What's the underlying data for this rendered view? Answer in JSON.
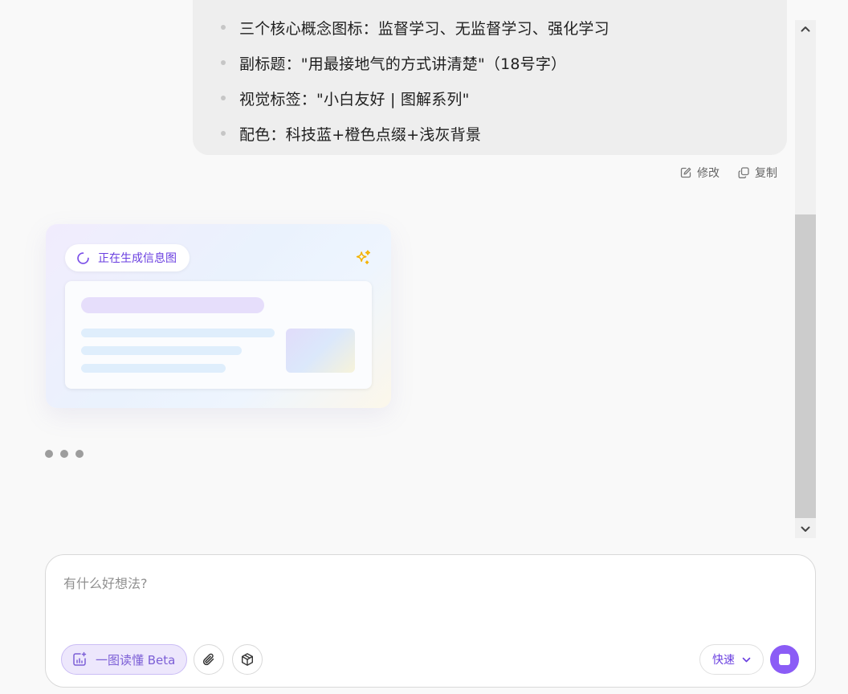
{
  "user_message": {
    "bullets": [
      "三个核心概念图标：监督学习、无监督学习、强化学习",
      "副标题：\"用最接地气的方式讲清楚\"（18号字）",
      "视觉标签：\"小白友好 | 图解系列\"",
      "配色：科技蓝+橙色点缀+浅灰背景"
    ],
    "actions": {
      "edit_label": "修改",
      "copy_label": "复制"
    }
  },
  "generation_card": {
    "status_text": "正在生成信息图"
  },
  "composer": {
    "placeholder": "有什么好想法?",
    "value": "",
    "chip_label": "一图读懂 Beta",
    "mode_label": "快速"
  },
  "icons": {
    "edit": "edit-icon",
    "copy": "copy-icon",
    "spinner": "spinner-icon",
    "sparkle": "sparkle-icon",
    "chart": "chart-icon",
    "attach": "paperclip-icon",
    "cube": "cube-icon",
    "chevron": "chevron-down-icon",
    "stop": "stop-icon"
  },
  "colors": {
    "accent": "#8b5cf6",
    "accent_text": "#6a3fe0",
    "sparkle": "#f5b301",
    "bubble_bg": "#eeeeee"
  }
}
